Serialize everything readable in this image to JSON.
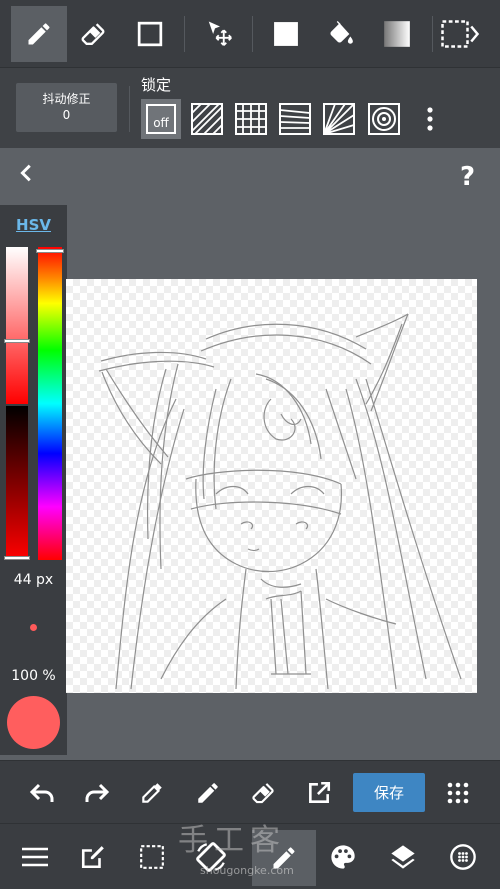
{
  "toolbar": {
    "tools": [
      "pen-tool",
      "eraser-tool",
      "shape-tool",
      "move-tool",
      "fill-rect-tool",
      "bucket-tool",
      "gradient-tool",
      "select-tool"
    ],
    "active": "pen-tool"
  },
  "options": {
    "stabilizer_label": "抖动修正",
    "stabilizer_value": "0",
    "lock_label": "锁定",
    "lock_off": "off"
  },
  "workspace": {
    "help": "?"
  },
  "color_panel": {
    "mode": "HSV",
    "brush_size": "44 px",
    "opacity": "100 %",
    "current_color": "#ff5e5e"
  },
  "actions": {
    "save_label": "保存"
  },
  "watermark": {
    "text": "手工客",
    "url": "shougongke.com"
  },
  "colors": {
    "accent": "#3e86c3",
    "toolbar_bg": "#3a3d41",
    "workspace_bg": "#5d6166"
  }
}
